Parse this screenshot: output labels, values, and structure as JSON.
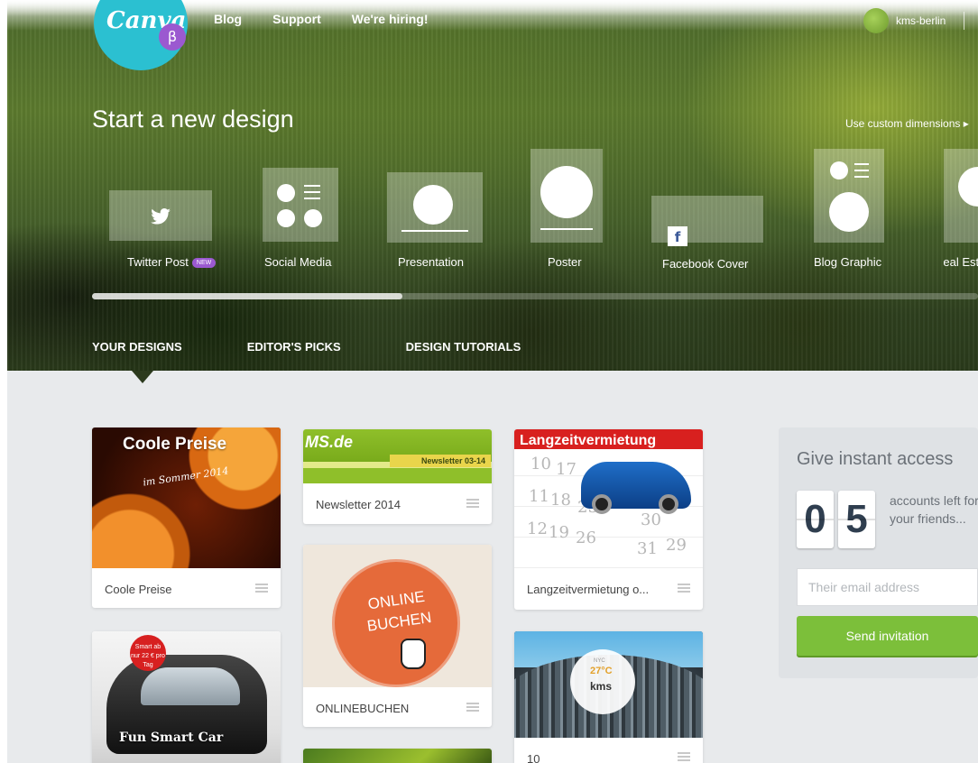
{
  "brand": {
    "name": "Canva",
    "beta": "β"
  },
  "topnav": {
    "links": [
      "Blog",
      "Support",
      "We're hiring!"
    ]
  },
  "user": {
    "name": "kms-berlin"
  },
  "hero": {
    "title": "Start a new design",
    "custom_dimensions": "Use custom dimensions ▸",
    "templates": [
      {
        "label": "Twitter Post",
        "badge": "NEW",
        "icon": "twitter-icon"
      },
      {
        "label": "Social Media",
        "icon": "grid-icon"
      },
      {
        "label": "Presentation",
        "icon": "presentation-icon"
      },
      {
        "label": "Poster",
        "icon": "poster-icon"
      },
      {
        "label": "Facebook Cover",
        "icon": "facebook-icon",
        "icon_text": "f"
      },
      {
        "label": "Blog Graphic",
        "icon": "blog-icon"
      },
      {
        "label": "Real Est",
        "icon": "real-estate-icon"
      }
    ],
    "scroll_position": 0.35
  },
  "tabs": [
    "YOUR DESIGNS",
    "EDITOR'S PICKS",
    "DESIGN TUTORIALS"
  ],
  "designs": {
    "col1": [
      {
        "title": "Coole Preise",
        "thumb_heading": "Coole Preise",
        "thumb_sub": "im Sommer 2014"
      },
      {
        "title": "Fun Smart Car",
        "thumb_badge": "Smart ab nur 22 € pro Tag",
        "thumb_caption": "Fun Smart Car"
      }
    ],
    "col2": [
      {
        "title": "Newsletter 2014",
        "thumb_logo": "MS.de",
        "thumb_tag": "Newsletter 03-14"
      },
      {
        "title": "ONLINEBUCHEN",
        "thumb_text": "ONLINE BUCHEN"
      },
      {
        "title": ""
      }
    ],
    "col3": [
      {
        "title": "Langzeitvermietung o...",
        "thumb_heading": "Langzeitvermietung",
        "thumb_numbers": [
          "10",
          "17",
          "11",
          "18",
          "25",
          "12",
          "19",
          "26",
          "31",
          "29",
          "30"
        ]
      },
      {
        "title": "10",
        "thumb_city": "NYC",
        "thumb_temp": "27°C",
        "thumb_name": "kms"
      }
    ]
  },
  "invite": {
    "heading": "Give instant access",
    "digits": [
      "0",
      "5"
    ],
    "accounts_text": "accounts left for your friends...",
    "email_placeholder": "Their email address",
    "button": "Send invitation"
  },
  "colors": {
    "brand": "#2bc0d1",
    "beta": "#9b59d0",
    "accent": "#7cbf3a",
    "background": "#e8eaec"
  }
}
